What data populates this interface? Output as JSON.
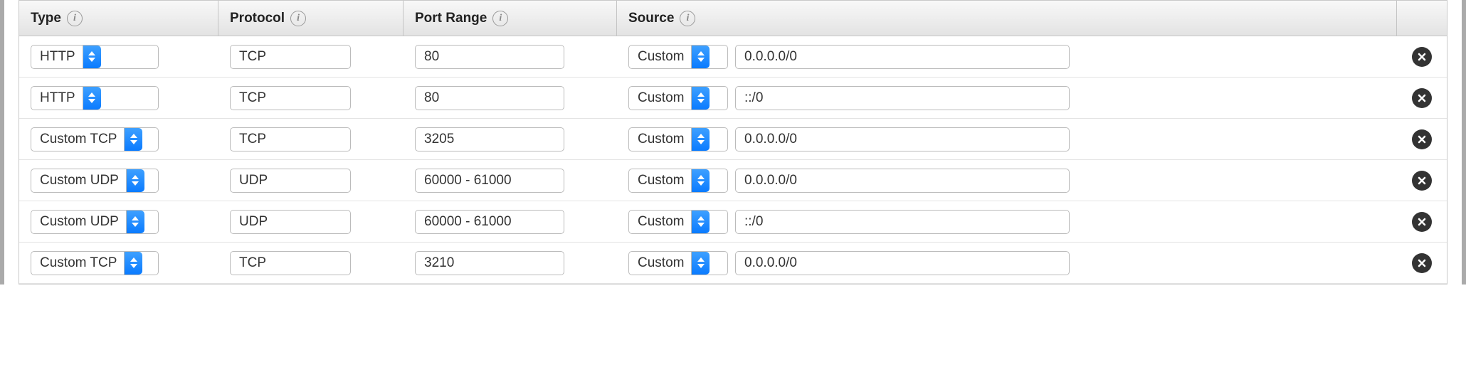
{
  "headers": {
    "type": "Type",
    "protocol": "Protocol",
    "port_range": "Port Range",
    "source": "Source"
  },
  "rules": [
    {
      "type": "HTTP",
      "protocol": "TCP",
      "port_range": "80",
      "source_mode": "Custom",
      "source_cidr": "0.0.0.0/0"
    },
    {
      "type": "HTTP",
      "protocol": "TCP",
      "port_range": "80",
      "source_mode": "Custom",
      "source_cidr": "::/0"
    },
    {
      "type": "Custom TCP",
      "protocol": "TCP",
      "port_range": "3205",
      "source_mode": "Custom",
      "source_cidr": "0.0.0.0/0"
    },
    {
      "type": "Custom UDP",
      "protocol": "UDP",
      "port_range": "60000 - 61000",
      "source_mode": "Custom",
      "source_cidr": "0.0.0.0/0"
    },
    {
      "type": "Custom UDP",
      "protocol": "UDP",
      "port_range": "60000 - 61000",
      "source_mode": "Custom",
      "source_cidr": "::/0"
    },
    {
      "type": "Custom TCP",
      "protocol": "TCP",
      "port_range": "3210",
      "source_mode": "Custom",
      "source_cidr": "0.0.0.0/0"
    }
  ]
}
